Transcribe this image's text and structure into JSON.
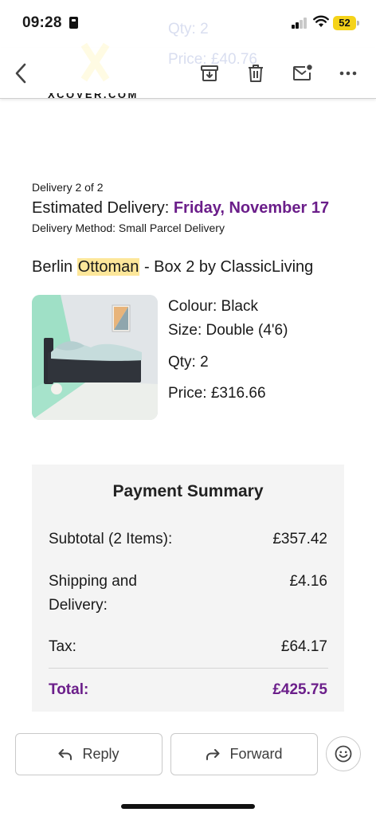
{
  "status": {
    "time": "09:28",
    "battery": "52",
    "signal_bars_filled": 2,
    "icons": [
      "id-card-icon",
      "signal-icon",
      "wifi-icon",
      "battery-icon"
    ]
  },
  "background_email": {
    "ghost_qty": "Qty: 2",
    "ghost_price": "Price: £40.76",
    "brand": "XCOVER.COM"
  },
  "toolbar": {
    "icons": [
      "back-chevron-icon",
      "archive-icon",
      "trash-icon",
      "mark-unread-icon",
      "more-icon"
    ]
  },
  "delivery": {
    "count": "Delivery 2 of 2",
    "estimated_label": "Estimated Delivery: ",
    "estimated_date": "Friday, November 17",
    "method": "Delivery Method: Small Parcel Delivery"
  },
  "product": {
    "title_before": "Berlin ",
    "title_highlight": "Ottoman",
    "title_after": " - Box 2 by ClassicLiving",
    "colour": "Colour: Black",
    "size": "Size: Double (4'6)",
    "qty": "Qty: 2",
    "price": "Price: £316.66"
  },
  "summary": {
    "title": "Payment Summary",
    "subtotal_label": "Subtotal (2 Items):",
    "subtotal_value": "£357.42",
    "shipping_label_1": "Shipping and",
    "shipping_label_2": "Delivery:",
    "shipping_value": "£4.16",
    "tax_label": "Tax:",
    "tax_value": "£64.17",
    "total_label": "Total:",
    "total_value": "£425.75"
  },
  "actions": {
    "reply": "Reply",
    "forward": "Forward",
    "icons": [
      "reply-icon",
      "forward-icon",
      "emoji-reaction-icon"
    ]
  },
  "colors": {
    "accent_purple": "#6b1e8a",
    "highlight": "#fde79a",
    "summary_bg": "#f4f4f4",
    "battery": "#f5d31a"
  }
}
